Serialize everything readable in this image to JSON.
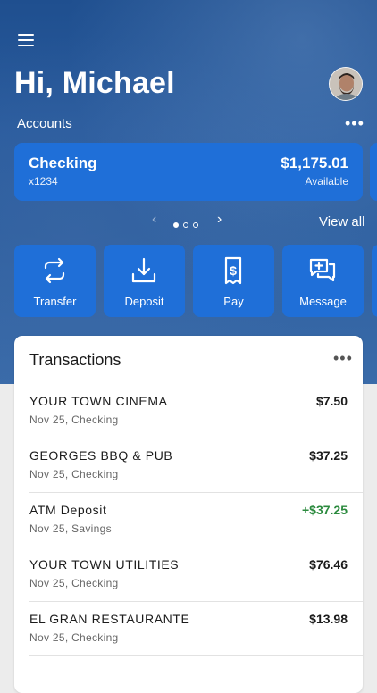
{
  "header": {
    "greeting": "Hi, Michael",
    "accounts_label": "Accounts",
    "more_label": "•••"
  },
  "account": {
    "name": "Checking",
    "number": "x1234",
    "balance": "$1,175.01",
    "balance_label": "Available"
  },
  "pager": {
    "prev_icon": "‹",
    "next_icon": "›",
    "pages": 3,
    "current_page": 1,
    "view_all": "View all"
  },
  "actions": [
    {
      "label": "Transfer",
      "icon": "transfer-icon"
    },
    {
      "label": "Deposit",
      "icon": "deposit-icon"
    },
    {
      "label": "Pay",
      "icon": "pay-icon"
    },
    {
      "label": "Message",
      "icon": "message-icon"
    }
  ],
  "transactions": {
    "title": "Transactions",
    "more_label": "•••",
    "items": [
      {
        "merchant": "YOUR TOWN CINEMA",
        "sub": "Nov 25, Checking",
        "amount": "$7.50",
        "credit": false
      },
      {
        "merchant": "GEORGES BBQ & PUB",
        "sub": "Nov 25, Checking",
        "amount": "$37.25",
        "credit": false
      },
      {
        "merchant": "ATM Deposit",
        "sub": "Nov 25, Savings",
        "amount": "+$37.25",
        "credit": true
      },
      {
        "merchant": "YOUR TOWN UTILITIES",
        "sub": "Nov 25, Checking",
        "amount": "$76.46",
        "credit": false
      },
      {
        "merchant": "EL GRAN RESTAURANTE",
        "sub": "Nov 25, Checking",
        "amount": "$13.98",
        "credit": false
      }
    ]
  },
  "colors": {
    "accent": "#1f6fd8",
    "credit": "#2b8a3e"
  }
}
